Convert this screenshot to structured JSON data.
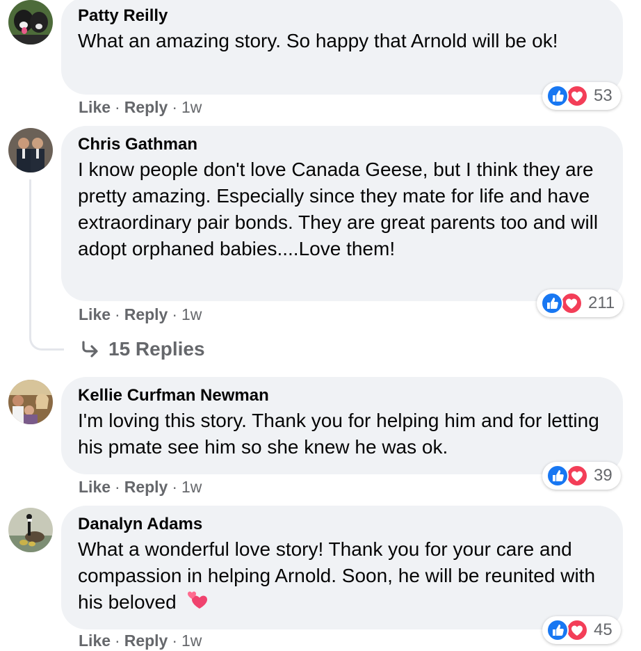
{
  "actions": {
    "like_label": "Like",
    "reply_label": "Reply",
    "separator": "·"
  },
  "colors": {
    "like_blue": "#1877f2",
    "love_red": "#f33e58",
    "secondary_text": "#65676b",
    "bubble_bg": "#f0f2f5"
  },
  "comments": [
    {
      "author": "Patty Reilly",
      "text": "What an amazing story. So happy that Arnold will be ok!",
      "time": "1w",
      "reaction_count": "53",
      "avatar_icon": "dog-photo-avatar"
    },
    {
      "author": "Chris Gathman",
      "text": "I know people don't love Canada Geese, but I think they are pretty amazing. Especially since they mate for life and have extraordinary pair bonds. They are great parents too and will adopt orphaned babies....Love them!",
      "time": "1w",
      "reaction_count": "211",
      "avatar_icon": "two-men-photo-avatar"
    },
    {
      "author": "Kellie Curfman Newman",
      "text": "I'm loving this story. Thank you for helping him and for letting his pmate see him so she knew he was ok.",
      "time": "1w",
      "reaction_count": "39",
      "avatar_icon": "group-photo-avatar"
    },
    {
      "author": "Danalyn Adams",
      "text": "What a wonderful love story! Thank you for your care and compassion in helping Arnold. Soon, he will be reunited with his beloved",
      "emoji": "revolving-hearts-emoji",
      "time": "1w",
      "reaction_count": "45",
      "avatar_icon": "goose-photo-avatar"
    }
  ],
  "replies": {
    "label": "15 Replies",
    "icon": "reply-arrow-icon"
  }
}
